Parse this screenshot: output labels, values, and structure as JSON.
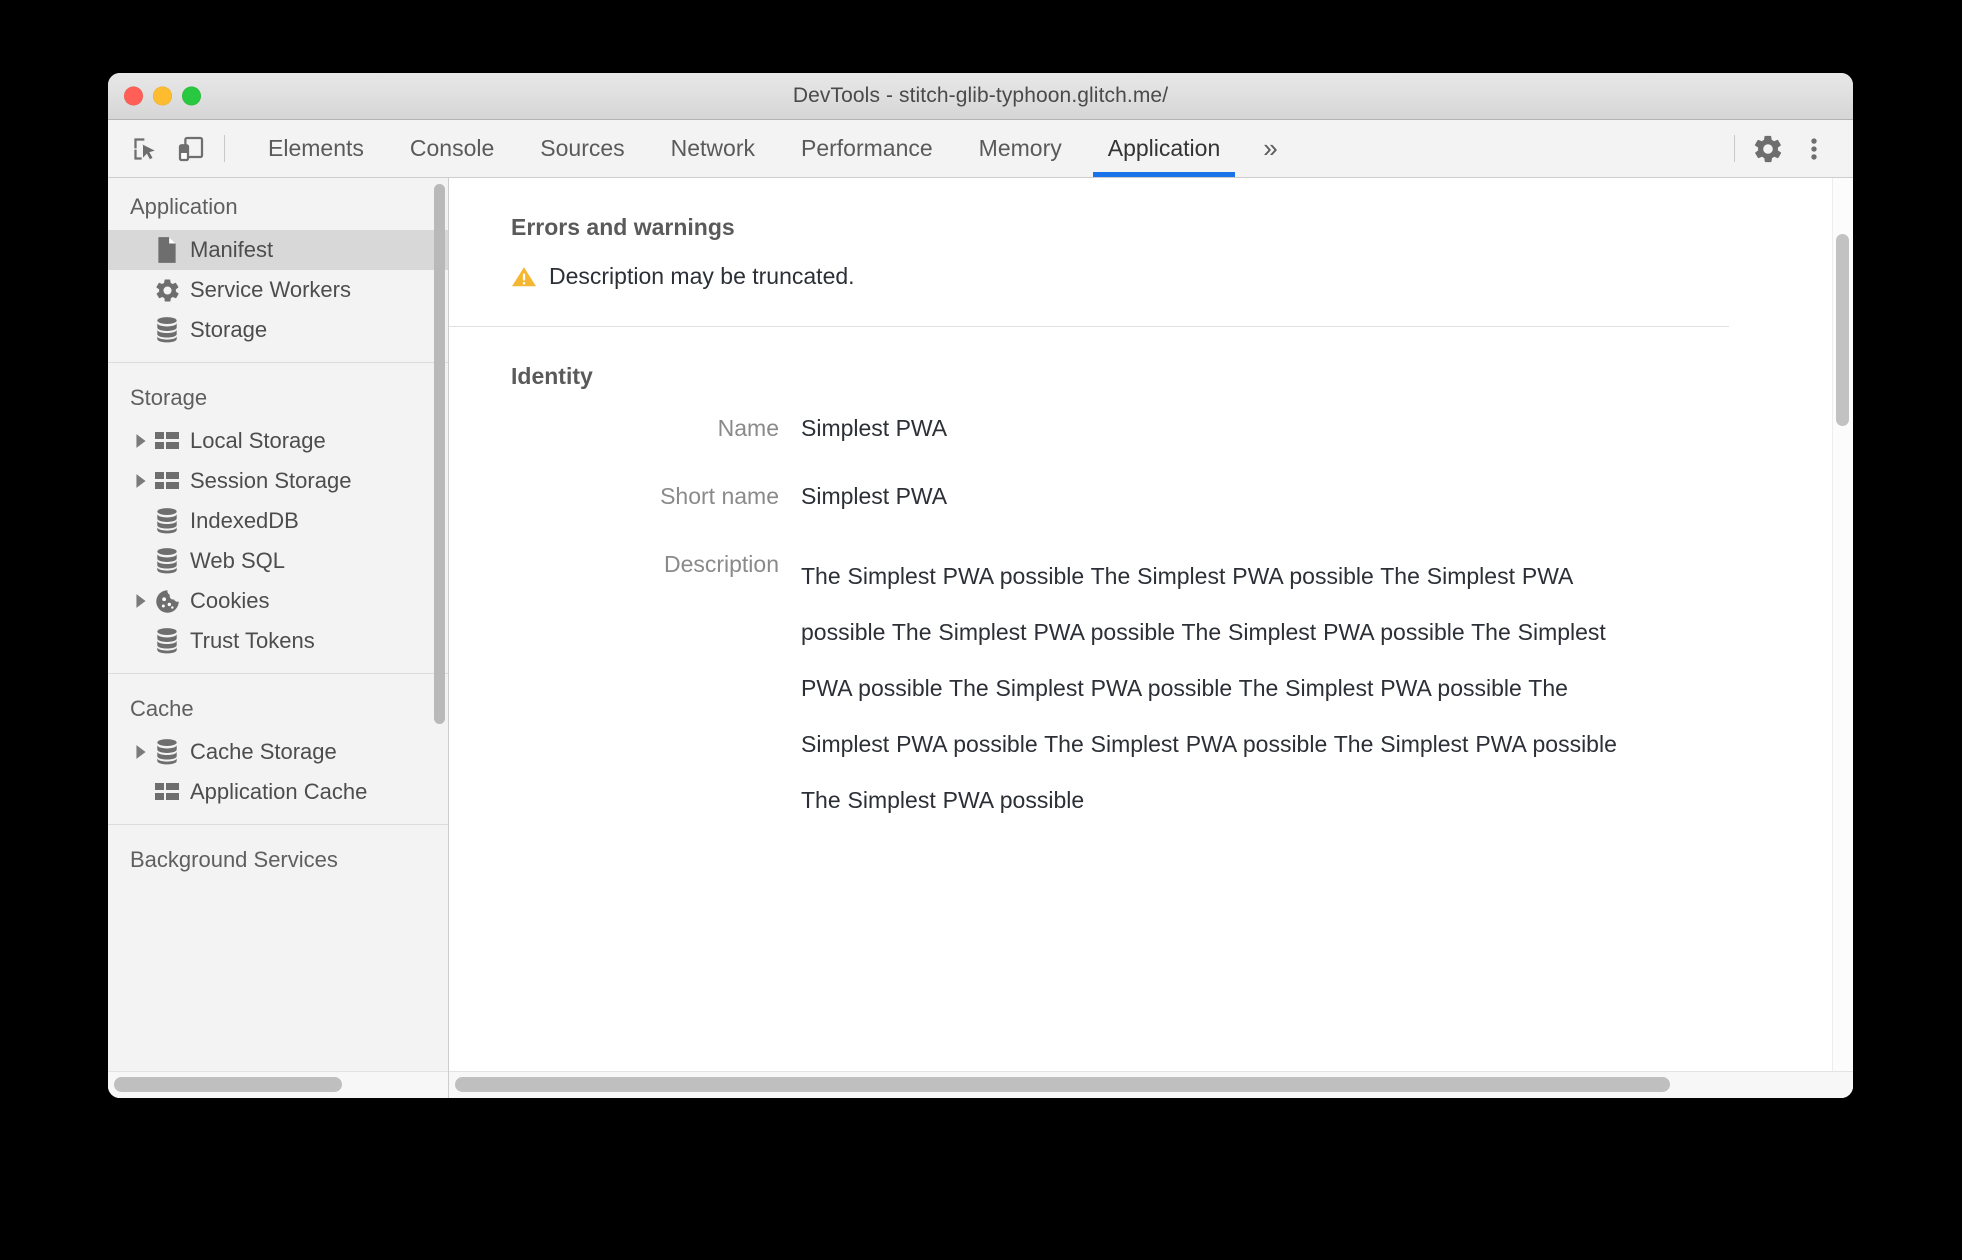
{
  "window": {
    "title": "DevTools - stitch-glib-typhoon.glitch.me/",
    "traffic_lights": [
      "close",
      "minimize",
      "zoom"
    ]
  },
  "toolbar": {
    "inspect_icon": "inspect-element-icon",
    "device_icon": "device-toolbar-icon",
    "settings_icon": "gear-icon",
    "more_icon": "kebab-menu-icon",
    "overflow_label": "»",
    "tabs": [
      {
        "label": "Elements",
        "active": false
      },
      {
        "label": "Console",
        "active": false
      },
      {
        "label": "Sources",
        "active": false
      },
      {
        "label": "Network",
        "active": false
      },
      {
        "label": "Performance",
        "active": false
      },
      {
        "label": "Memory",
        "active": false
      },
      {
        "label": "Application",
        "active": true
      }
    ]
  },
  "sidebar": {
    "groups": [
      {
        "title": "Application",
        "items": [
          {
            "label": "Manifest",
            "icon": "document-icon",
            "twisty": false,
            "selected": true
          },
          {
            "label": "Service Workers",
            "icon": "gear-icon",
            "twisty": false,
            "selected": false
          },
          {
            "label": "Storage",
            "icon": "database-icon",
            "twisty": false,
            "selected": false
          }
        ]
      },
      {
        "title": "Storage",
        "items": [
          {
            "label": "Local Storage",
            "icon": "table-icon",
            "twisty": true,
            "selected": false
          },
          {
            "label": "Session Storage",
            "icon": "table-icon",
            "twisty": true,
            "selected": false
          },
          {
            "label": "IndexedDB",
            "icon": "database-icon",
            "twisty": false,
            "selected": false
          },
          {
            "label": "Web SQL",
            "icon": "database-icon",
            "twisty": false,
            "selected": false
          },
          {
            "label": "Cookies",
            "icon": "cookie-icon",
            "twisty": true,
            "selected": false
          },
          {
            "label": "Trust Tokens",
            "icon": "database-icon",
            "twisty": false,
            "selected": false
          }
        ]
      },
      {
        "title": "Cache",
        "items": [
          {
            "label": "Cache Storage",
            "icon": "database-icon",
            "twisty": true,
            "selected": false
          },
          {
            "label": "Application Cache",
            "icon": "table-icon",
            "twisty": false,
            "selected": false
          }
        ]
      },
      {
        "title": "Background Services",
        "items": []
      }
    ]
  },
  "main": {
    "errors_section": {
      "title": "Errors and warnings",
      "warning_icon": "warning-triangle-icon",
      "warning_text": "Description may be truncated."
    },
    "identity_section": {
      "title": "Identity",
      "fields": [
        {
          "label": "Name",
          "value": "Simplest PWA",
          "wrapped": false
        },
        {
          "label": "Short name",
          "value": "Simplest PWA",
          "wrapped": false
        },
        {
          "label": "Description",
          "value": "The Simplest PWA possible The Simplest PWA possible The Simplest PWA possible The Simplest PWA possible The Simplest PWA possible The Simplest PWA possible The Simplest PWA possible The Simplest PWA possible The Simplest PWA possible The Simplest PWA possible The Simplest PWA possible The Simplest PWA possible",
          "wrapped": true
        }
      ]
    }
  },
  "colors": {
    "accent": "#1a73e8",
    "warning": "#f5b731",
    "selected_row": "#d8d8d8",
    "icon_gray": "#6e6e6e",
    "panel_bg": "#f3f3f3"
  }
}
